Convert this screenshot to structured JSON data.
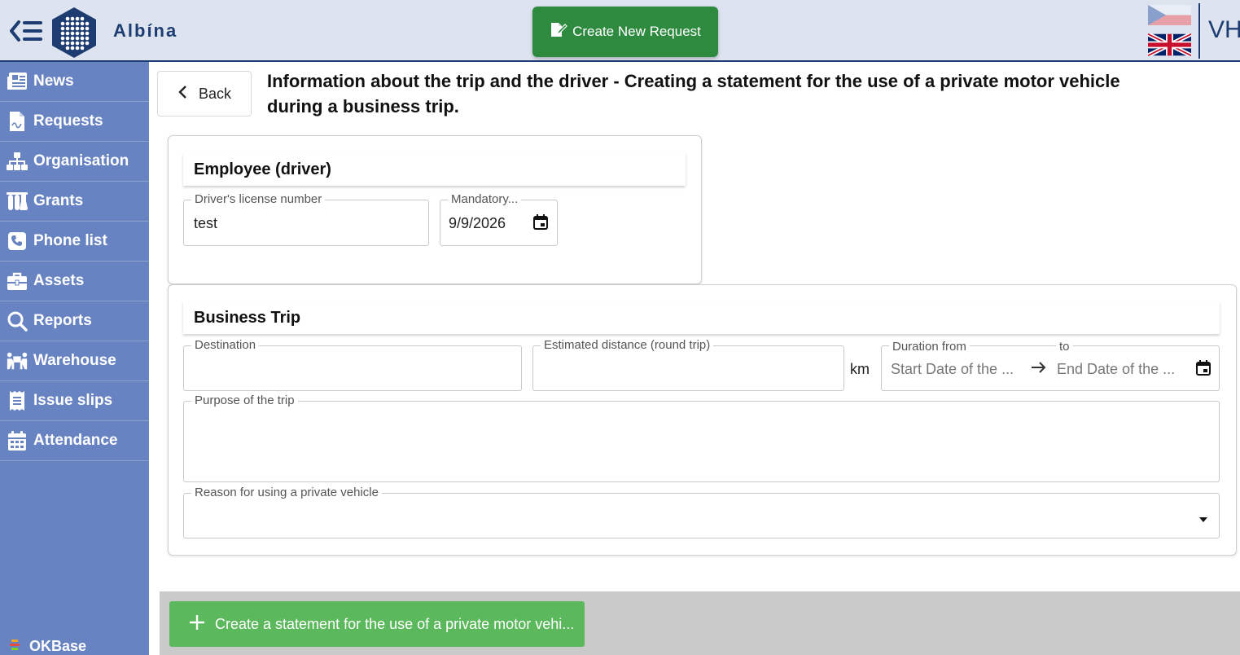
{
  "header": {
    "app_name": "Albína",
    "create_button_label": "Create New Request",
    "user_initials": "VH"
  },
  "sidebar": {
    "items": [
      {
        "label": "News",
        "icon": "newspaper-icon"
      },
      {
        "label": "Requests",
        "icon": "document-icon"
      },
      {
        "label": "Organisation",
        "icon": "org-chart-icon"
      },
      {
        "label": "Grants",
        "icon": "flask-icon"
      },
      {
        "label": "Phone list",
        "icon": "phone-icon"
      },
      {
        "label": "Assets",
        "icon": "briefcase-icon"
      },
      {
        "label": "Reports",
        "icon": "search-icon"
      },
      {
        "label": "Warehouse",
        "icon": "people-carry-icon"
      },
      {
        "label": "Issue slips",
        "icon": "receipt-icon"
      },
      {
        "label": "Attendance",
        "icon": "calendar-icon"
      }
    ],
    "footer": "OKBase"
  },
  "main": {
    "back_label": "Back",
    "title": "Information about the trip and the driver - Creating a statement for the use of a private motor vehicle during a business trip.",
    "employee_section": {
      "heading": "Employee (driver)",
      "license_label": "Driver's license number",
      "license_value": "test",
      "mandatory_label": "Mandatory...",
      "mandatory_value": "9/9/2026"
    },
    "trip_section": {
      "heading": "Business Trip",
      "destination_label": "Destination",
      "distance_label": "Estimated distance (round trip)",
      "distance_unit": "km",
      "duration_from_label": "Duration from",
      "duration_to_label": "to",
      "start_placeholder": "Start Date of the ...",
      "end_placeholder": "End Date of the ...",
      "purpose_label": "Purpose of the trip",
      "reason_label": "Reason for using a private vehicle"
    },
    "submit_label": "Create a statement for the use of a private motor vehi..."
  }
}
